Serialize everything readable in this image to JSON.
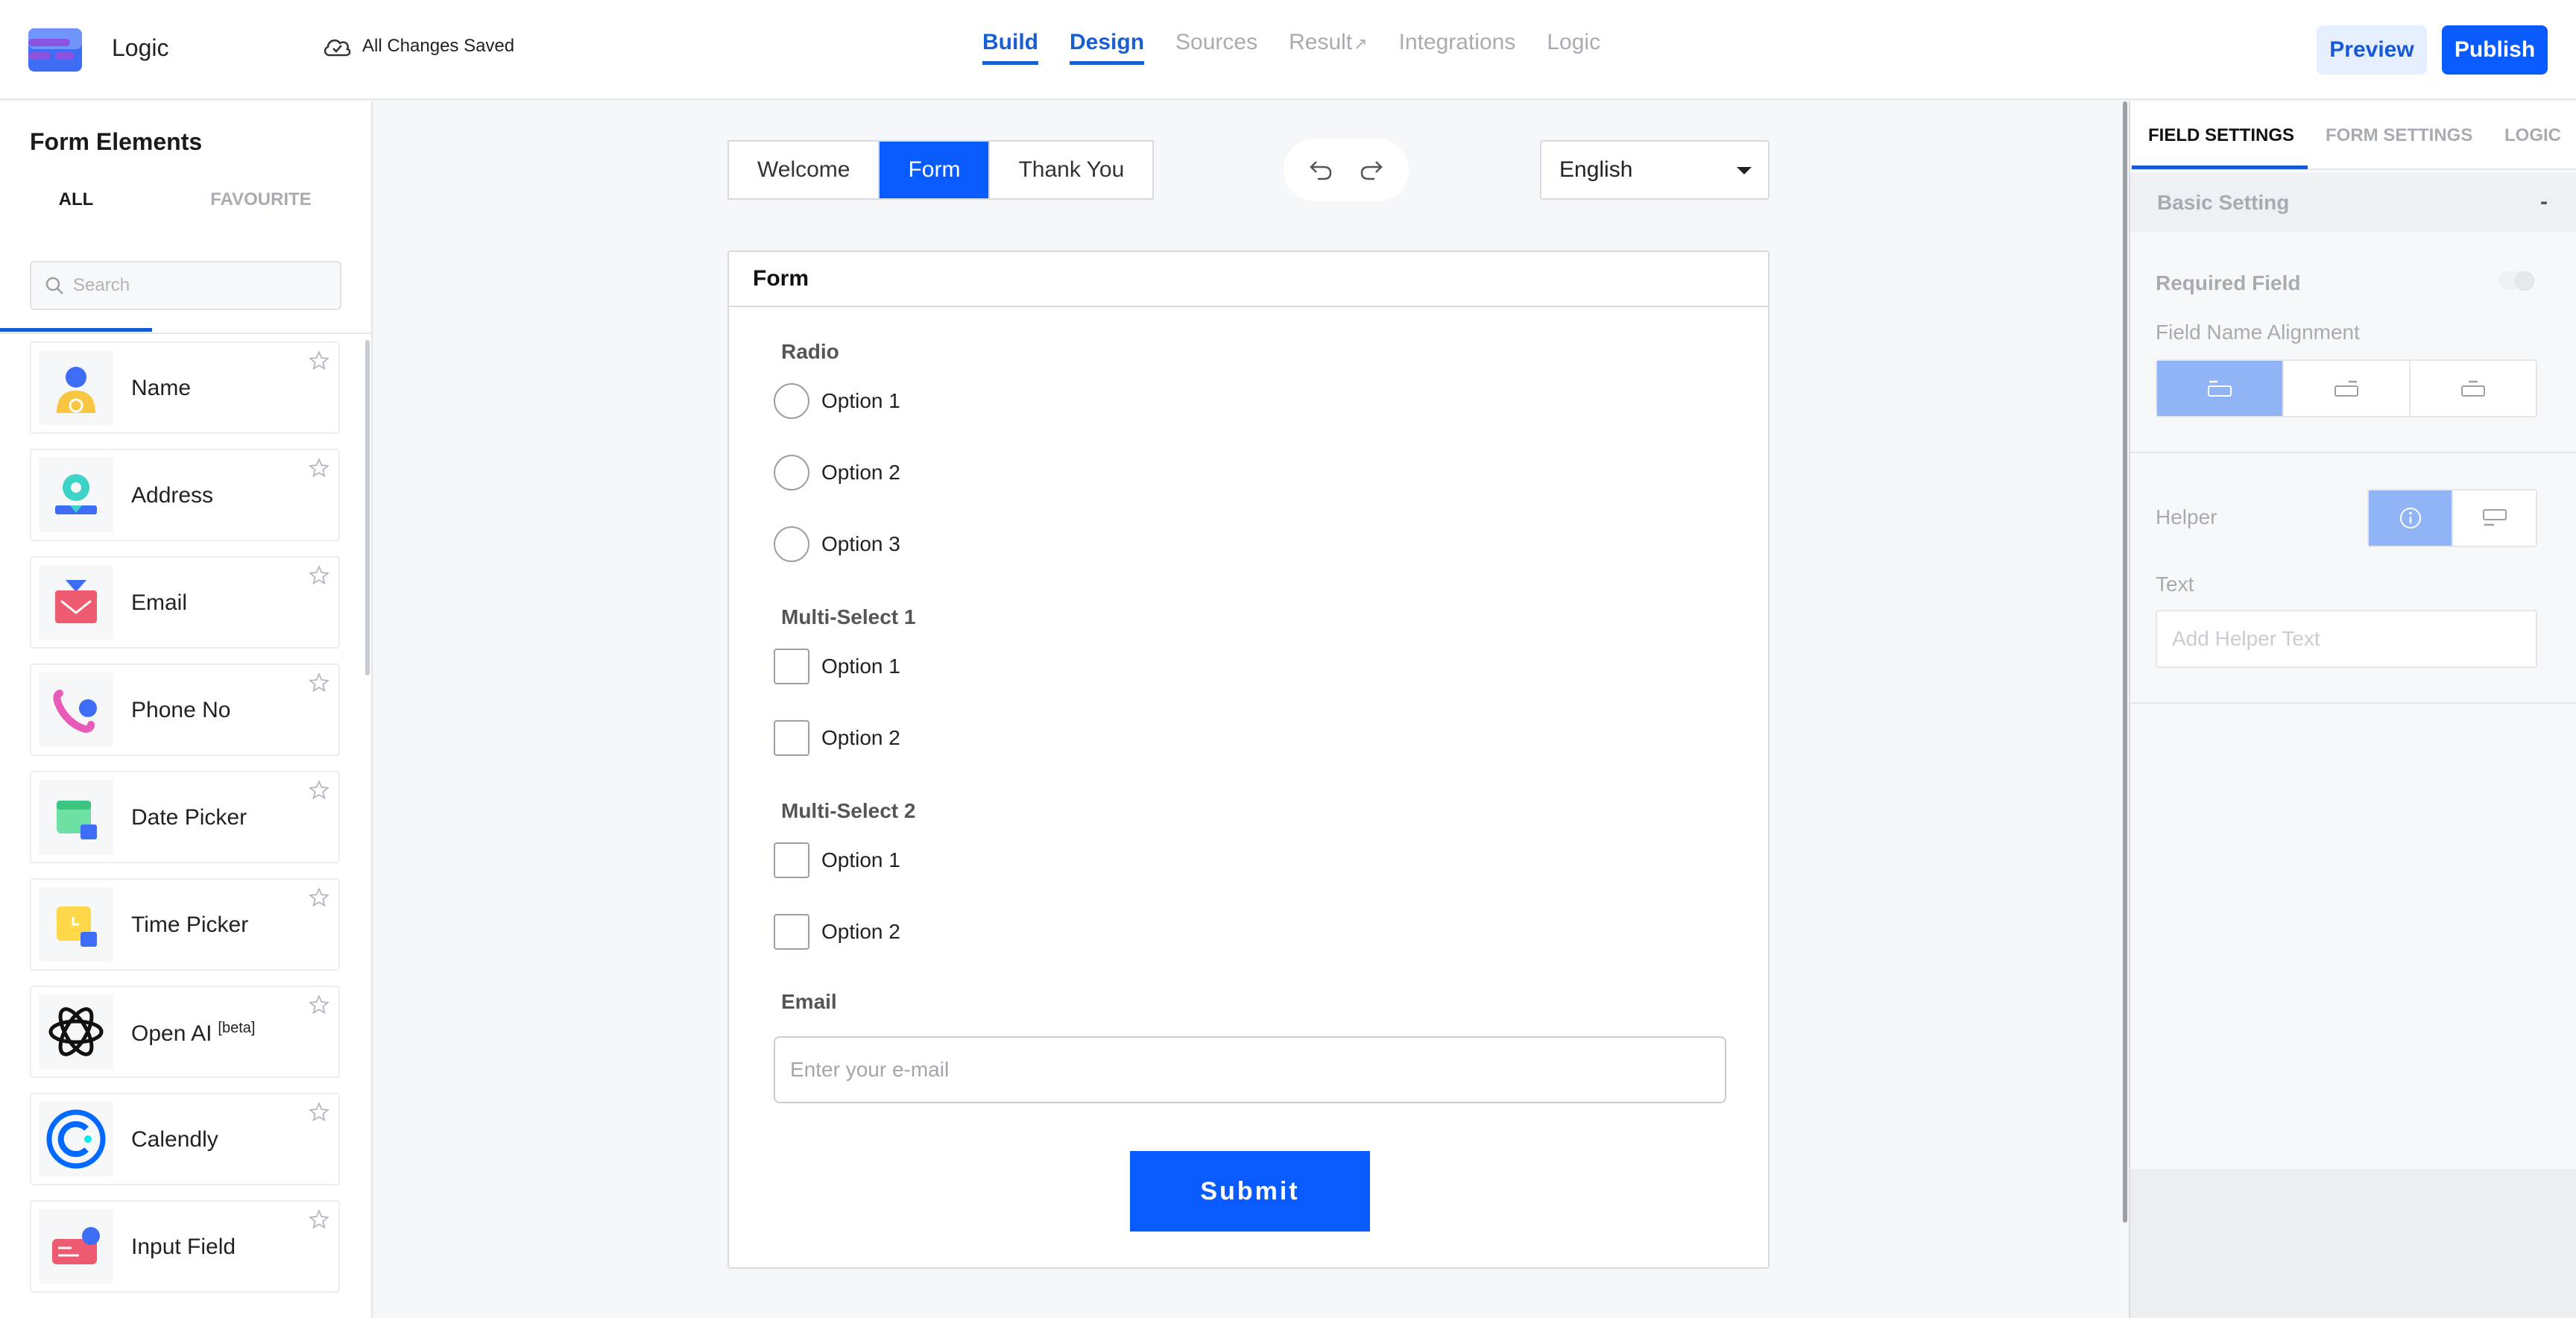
{
  "app": {
    "name": "Logic",
    "save_status": "All Changes Saved"
  },
  "nav": {
    "tabs": [
      "Build",
      "Design",
      "Sources",
      "Result",
      "Integrations",
      "Logic"
    ],
    "active": [
      "Build",
      "Design"
    ]
  },
  "header_actions": {
    "preview": "Preview",
    "publish": "Publish"
  },
  "left_panel": {
    "title": "Form Elements",
    "tabs": {
      "all": "ALL",
      "favourite": "FAVOURITE"
    },
    "search_placeholder": "Search",
    "elements": [
      {
        "label": "Name",
        "icon": "person-icon"
      },
      {
        "label": "Address",
        "icon": "location-icon"
      },
      {
        "label": "Email",
        "icon": "envelope-icon"
      },
      {
        "label": "Phone No",
        "icon": "phone-icon"
      },
      {
        "label": "Date Picker",
        "icon": "calendar-icon"
      },
      {
        "label": "Time Picker",
        "icon": "clock-icon"
      },
      {
        "label": "Open AI",
        "badge": "[beta]",
        "icon": "openai-icon"
      },
      {
        "label": "Calendly",
        "icon": "calendly-icon"
      },
      {
        "label": "Input Field",
        "icon": "input-field-icon"
      }
    ]
  },
  "canvas": {
    "page_tabs": [
      "Welcome",
      "Form",
      "Thank You"
    ],
    "active_page": "Form",
    "language": "English",
    "form": {
      "title": "Form",
      "radio": {
        "label": "Radio",
        "options": [
          "Option 1",
          "Option 2",
          "Option 3"
        ]
      },
      "multi_select_1": {
        "label": "Multi-Select 1",
        "options": [
          "Option 1",
          "Option 2"
        ]
      },
      "multi_select_2": {
        "label": "Multi-Select 2",
        "options": [
          "Option 1",
          "Option 2"
        ]
      },
      "email": {
        "label": "Email",
        "placeholder": "Enter your e-mail",
        "value": ""
      },
      "submit_label": "Submit"
    }
  },
  "right_panel": {
    "tabs": [
      "FIELD SETTINGS",
      "FORM SETTINGS",
      "LOGIC"
    ],
    "active_tab": "FIELD SETTINGS",
    "section": "Basic Setting",
    "section_toggle": "-",
    "required_field": "Required Field",
    "field_name_alignment": "Field Name Alignment",
    "helper": "Helper",
    "text": "Text",
    "helper_placeholder": "Add Helper Text"
  },
  "colors": {
    "accent": "#0a5bff",
    "nav_active": "#1a5fd0",
    "muted": "#a7abb2",
    "selected_toggle": "#91b4f6"
  }
}
